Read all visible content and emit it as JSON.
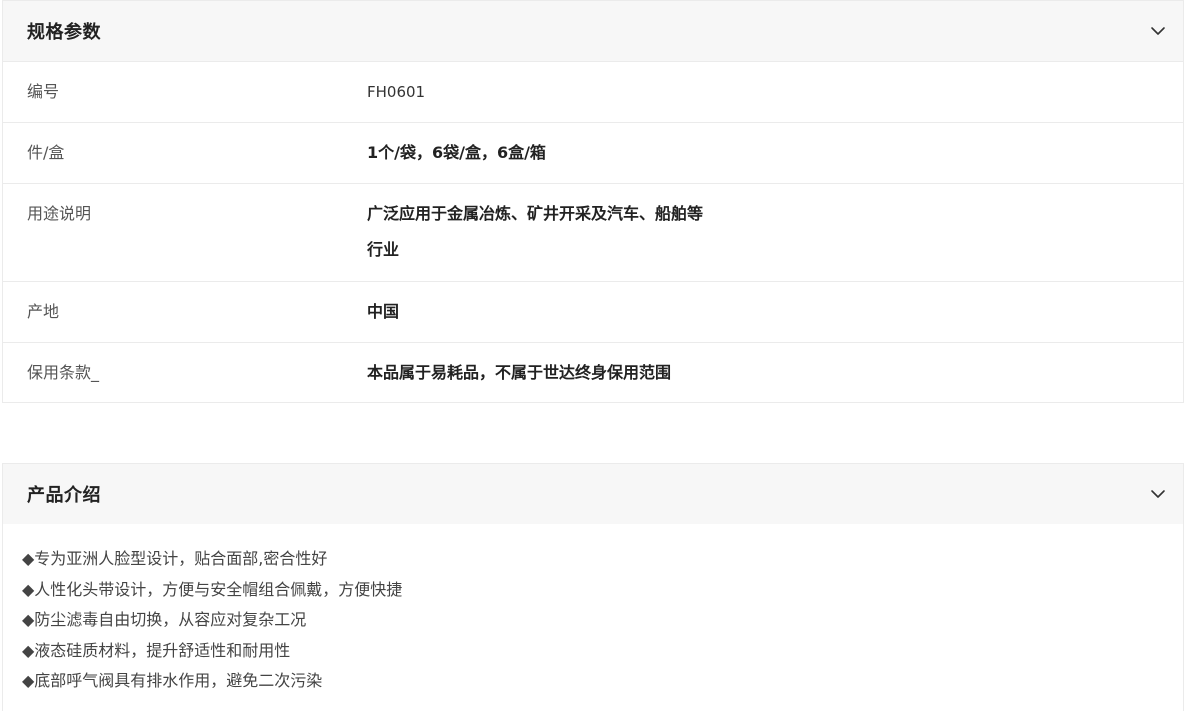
{
  "specs": {
    "title": "规格参数",
    "rows": [
      {
        "label": "编号",
        "value": "FH0601"
      },
      {
        "label": "件/盒",
        "value": "1个/袋，6袋/盒，6盒/箱"
      },
      {
        "label": "用途说明",
        "value": "广泛应用于金属冶炼、矿井开采及汽车、船舶等行业"
      },
      {
        "label": "产地",
        "value": "中国"
      },
      {
        "label": "保用条款_",
        "value": "本品属于易耗品，不属于世达终身保用范围"
      }
    ]
  },
  "intro": {
    "title": "产品介绍",
    "lines": [
      "◆专为亚洲人脸型设计，贴合面部,密合性好",
      "◆人性化头带设计，方便与安全帽组合佩戴，方便快捷",
      "◆防尘滤毒自由切换，从容应对复杂工况",
      "◆液态硅质材料，提升舒适性和耐用性",
      "◆底部呼气阀具有排水作用，避免二次污染"
    ]
  }
}
